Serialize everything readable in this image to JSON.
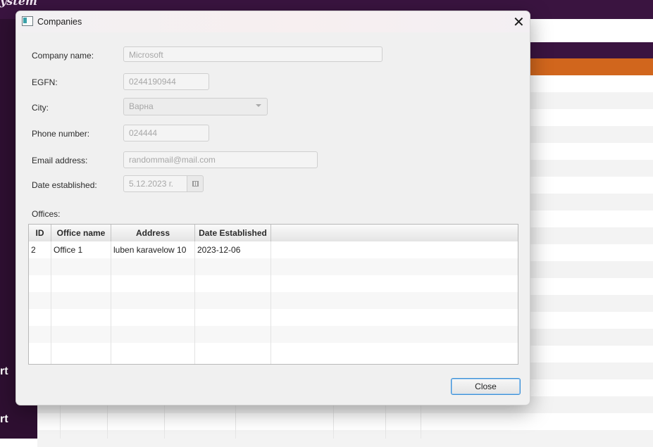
{
  "background": {
    "brand_text": "ystem",
    "sidebar_items": [
      "rt",
      "rt"
    ]
  },
  "dialog": {
    "title": "Companies",
    "close_glyph": "✕",
    "form": {
      "company_name": {
        "label": "Company name:",
        "value": "Microsoft"
      },
      "egfn": {
        "label": "EGFN:",
        "value": "0244190944"
      },
      "city": {
        "label": "City:",
        "value": "Варна"
      },
      "phone": {
        "label": "Phone number:",
        "value": "024444"
      },
      "email": {
        "label": "Email address:",
        "value": "randommail@mail.com"
      },
      "date": {
        "label": "Date established:",
        "value": "5.12.2023 г."
      }
    },
    "offices_label": "Offices:",
    "table": {
      "columns": [
        "ID",
        "Office name",
        "Address",
        "Date Established"
      ],
      "rows": [
        {
          "id": "2",
          "name": "Office 1",
          "address": "luben karavelow 10",
          "date": "2023-12-06"
        }
      ]
    },
    "close_button_label": "Close"
  },
  "icons": {
    "window": "window-icon",
    "calendar": "calendar-icon",
    "dropdown": "chevron-down-icon",
    "close": "close-icon"
  }
}
